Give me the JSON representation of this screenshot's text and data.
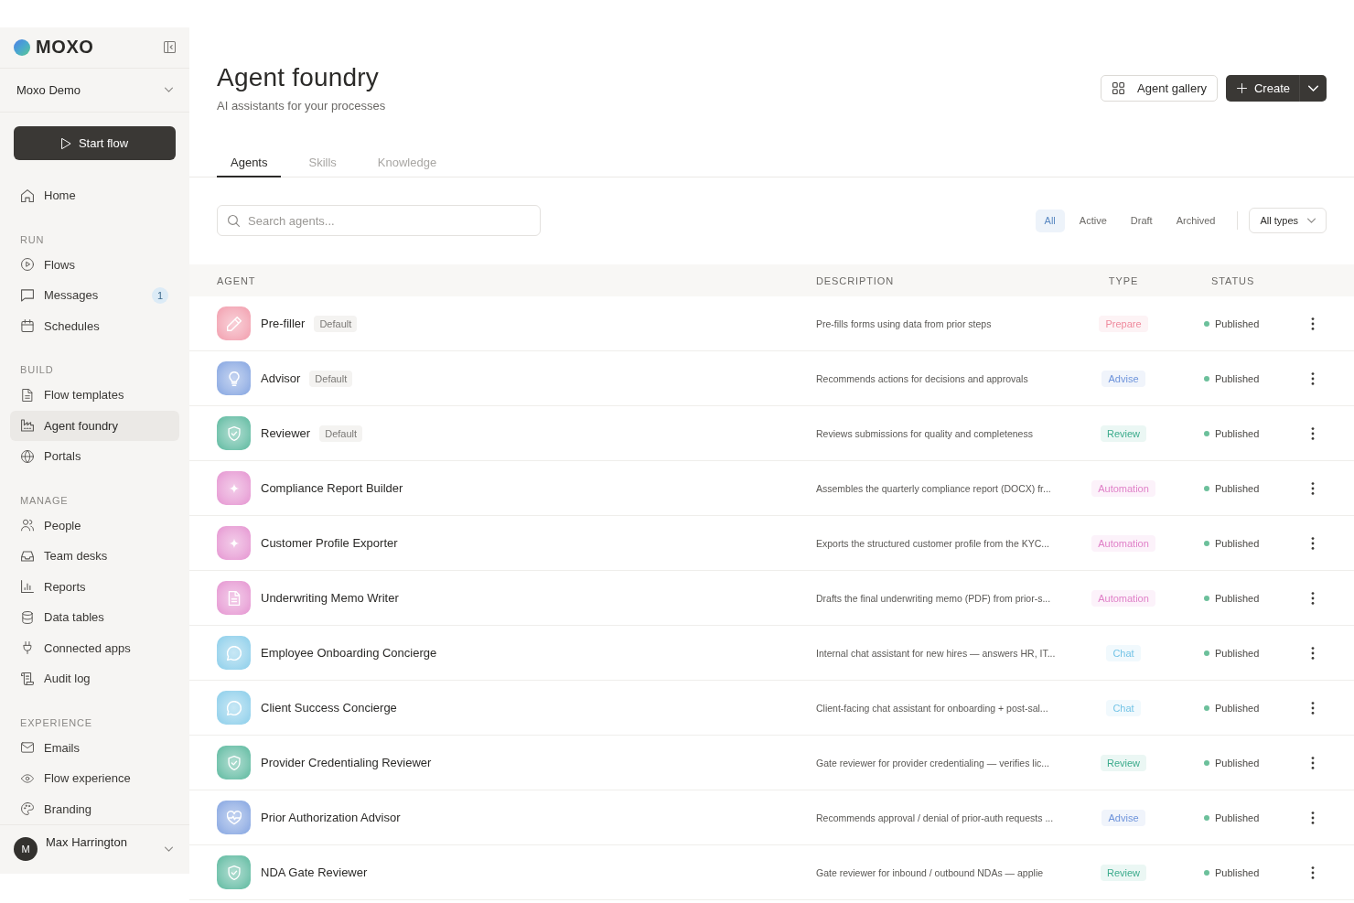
{
  "sidebar": {
    "logo": "MOXO",
    "workspace": "Moxo Demo",
    "start_button": "Start flow",
    "sections": [
      {
        "items": [
          {
            "label": "Home",
            "selected": false
          }
        ]
      },
      {
        "title": "RUN",
        "items": [
          {
            "label": "Flows",
            "selected": false
          },
          {
            "label": "Messages",
            "selected": false,
            "count": "1"
          },
          {
            "label": "Schedules",
            "selected": false
          }
        ]
      },
      {
        "title": "BUILD",
        "items": [
          {
            "label": "Flow templates",
            "selected": false
          },
          {
            "label": "Agent foundry",
            "selected": true
          },
          {
            "label": "Portals",
            "selected": false
          }
        ]
      },
      {
        "title": "MANAGE",
        "items": [
          {
            "label": "People",
            "selected": false
          },
          {
            "label": "Team desks",
            "selected": false
          },
          {
            "label": "Reports",
            "selected": false
          },
          {
            "label": "Data tables",
            "selected": false
          },
          {
            "label": "Connected apps",
            "selected": false
          },
          {
            "label": "Audit log",
            "selected": false
          }
        ]
      },
      {
        "title": "EXPERIENCE",
        "items": [
          {
            "label": "Emails",
            "selected": false
          },
          {
            "label": "Flow experience",
            "selected": false
          },
          {
            "label": "Branding",
            "selected": false
          }
        ]
      }
    ],
    "user": {
      "initial": "M",
      "name": "Max Harrington"
    }
  },
  "header": {
    "title": "Agent foundry",
    "subtitle": "AI assistants for your processes",
    "gallery_button": "Agent gallery",
    "create_button": "Create"
  },
  "tabs": [
    {
      "label": "Agents",
      "selected": true
    },
    {
      "label": "Skills",
      "selected": false
    },
    {
      "label": "Knowledge",
      "selected": false
    }
  ],
  "search": {
    "placeholder": "Search agents..."
  },
  "status_filters": [
    {
      "label": "All",
      "selected": true
    },
    {
      "label": "Active",
      "selected": false
    },
    {
      "label": "Draft",
      "selected": false
    },
    {
      "label": "Archived",
      "selected": false
    }
  ],
  "type_filter": {
    "value": "All types"
  },
  "table": {
    "columns": [
      "AGENT",
      "DESCRIPTION",
      "TYPE",
      "STATUS"
    ],
    "rows": [
      {
        "name": "Pre-filler",
        "badge": "Default",
        "description": "Pre-fills forms using data from prior steps",
        "type": {
          "label": "Prepare",
          "color": "#ef8a9d"
        },
        "status": "Published"
      },
      {
        "name": "Advisor",
        "badge": "Default",
        "description": "Recommends actions for decisions and approvals",
        "type": {
          "label": "Advise",
          "color": "#6d93db"
        },
        "status": "Published"
      },
      {
        "name": "Reviewer",
        "badge": "Default",
        "description": "Reviews submissions for quality and completeness",
        "type": {
          "label": "Review",
          "color": "#3bab8c"
        },
        "status": "Published"
      },
      {
        "name": "Compliance Report Builder",
        "description": "Assembles the quarterly compliance report (DOCX) fr...",
        "type": {
          "label": "Automation",
          "color": "#e080c8"
        },
        "status": "Published"
      },
      {
        "name": "Customer Profile Exporter",
        "description": "Exports the structured customer profile from the KYC...",
        "type": {
          "label": "Automation",
          "color": "#e080c8"
        },
        "status": "Published"
      },
      {
        "name": "Underwriting Memo Writer",
        "description": "Drafts the final underwriting memo (PDF) from prior-s...",
        "type": {
          "label": "Automation",
          "color": "#e080c8"
        },
        "status": "Published"
      },
      {
        "name": "Employee Onboarding Concierge",
        "description": "Internal chat assistant for new hires — answers HR, IT...",
        "type": {
          "label": "Chat",
          "color": "#74c4e6"
        },
        "status": "Published"
      },
      {
        "name": "Client Success Concierge",
        "description": "Client-facing chat assistant for onboarding + post-sal...",
        "type": {
          "label": "Chat",
          "color": "#74c4e6"
        },
        "status": "Published"
      },
      {
        "name": "Provider Credentialing Reviewer",
        "description": "Gate reviewer for provider credentialing — verifies lic...",
        "type": {
          "label": "Review",
          "color": "#3bab8c"
        },
        "status": "Published"
      },
      {
        "name": "Prior Authorization Advisor",
        "description": "Recommends approval / denial of prior-auth requests ...",
        "type": {
          "label": "Advise",
          "color": "#6d93db"
        },
        "status": "Published"
      },
      {
        "name": "NDA Gate Reviewer",
        "description": "Gate reviewer for inbound / outbound NDAs — applie",
        "type": {
          "label": "Review",
          "color": "#3bab8c"
        },
        "status": "Published"
      }
    ]
  }
}
